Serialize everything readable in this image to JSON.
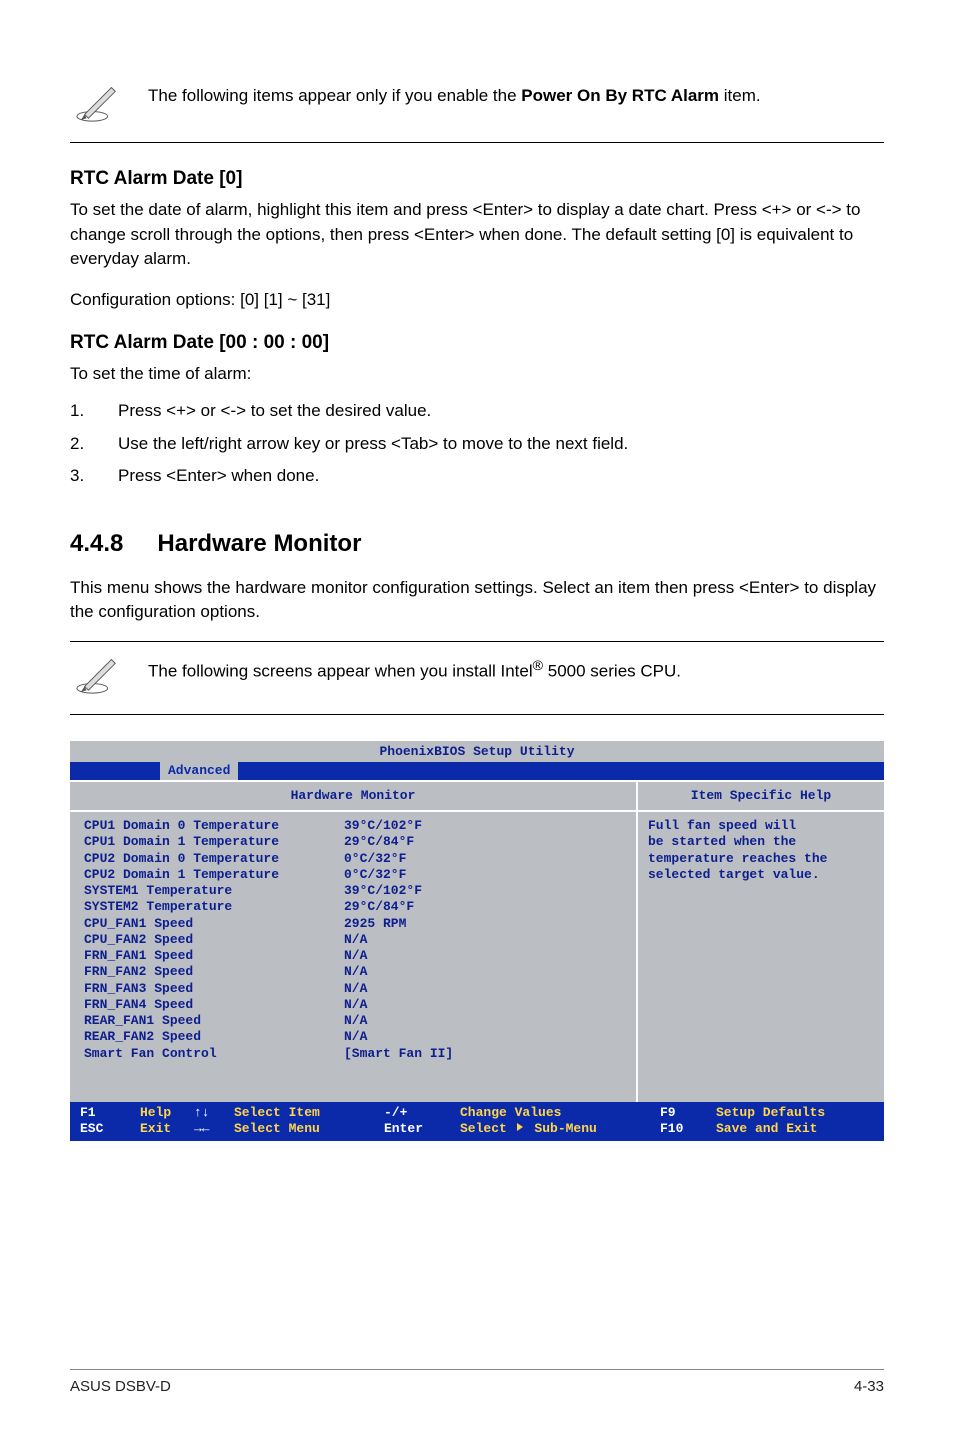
{
  "note1": {
    "text_a": "The following items appear only if you enable the ",
    "text_b": "Power On By RTC Alarm",
    "text_c": " item."
  },
  "sec1": {
    "heading": "RTC Alarm Date [0]",
    "para_a": "To set the date of alarm, highlight this item and press <Enter> to display a date chart. Press <+> or <-> to change scroll through the options, then press <Enter> when done. The default setting [0] is equivalent to everyday alarm.",
    "para_b": "Configuration options: [0] [1] ~ [31]"
  },
  "sec2": {
    "heading": "RTC Alarm Date [00 : 00 : 00]",
    "intro": "To set the time of alarm:",
    "items": {
      "n1": "1.",
      "t1": "Press <+> or <-> to set the desired value.",
      "n2": "2.",
      "t2": "Use the left/right arrow key or press <Tab> to move to the next field.",
      "n3": "3.",
      "t3": "Press <Enter> when done."
    }
  },
  "sec3": {
    "num": "4.4.8",
    "name": "Hardware Monitor",
    "para": "This menu shows the hardware monitor configuration settings.  Select an item then press <Enter> to display the configuration options."
  },
  "note2": {
    "text_a": "The following screens appear when you install Intel",
    "text_b": "®",
    "text_c": " 5000 series CPU."
  },
  "bios": {
    "title": "PhoenixBIOS Setup Utility",
    "tab": "Advanced",
    "left_header": "Hardware Monitor",
    "right_header": "Item Specific Help",
    "help": {
      "l1": "Full fan speed will",
      "l2": "be started when the",
      "l3": "temperature reaches the",
      "l4": "selected target value."
    },
    "rows": {
      "r0l": "CPU1 Domain 0 Temperature",
      "r0v": "39°C/102°F",
      "r1l": "CPU1 Domain 1 Temperature",
      "r1v": "29°C/84°F",
      "r2l": "CPU2 Domain 0 Temperature",
      "r2v": "0°C/32°F",
      "r3l": "CPU2 Domain 1 Temperature",
      "r3v": "0°C/32°F",
      "r4l": "SYSTEM1 Temperature",
      "r4v": "39°C/102°F",
      "r5l": "SYSTEM2 Temperature",
      "r5v": "29°C/84°F",
      "r6l": "CPU_FAN1 Speed",
      "r6v": "2925 RPM",
      "r7l": "CPU_FAN2 Speed",
      "r7v": "N/A",
      "r8l": "FRN_FAN1 Speed",
      "r8v": "N/A",
      "r9l": "FRN_FAN2 Speed",
      "r9v": "N/A",
      "r10l": "FRN_FAN3 Speed",
      "r10v": "N/A",
      "r11l": "FRN_FAN4 Speed",
      "r11v": "N/A",
      "r12l": "REAR_FAN1 Speed",
      "r12v": "N/A",
      "r13l": "REAR_FAN2 Speed",
      "r13v": "N/A",
      "r14l": "Smart Fan Control",
      "r14v": "[Smart Fan II]"
    },
    "footer": {
      "k1a": "F1",
      "l1a": "Help",
      "k1b": "ESC",
      "l1b": "Exit",
      "k2a": "↑↓",
      "l2a": "Select Item",
      "k2b": "→←",
      "l2b": "Select Menu",
      "k3a": "-/+",
      "l3a": "Change Values",
      "k3b": "Enter",
      "l3b_a": "Select ",
      "l3b_b": " Sub-Menu",
      "k4a": "F9",
      "l4a": "Setup Defaults",
      "k4b": "F10",
      "l4b": "Save and Exit"
    }
  },
  "pagefoot": {
    "left": "ASUS DSBV-D",
    "right": "4-33"
  }
}
